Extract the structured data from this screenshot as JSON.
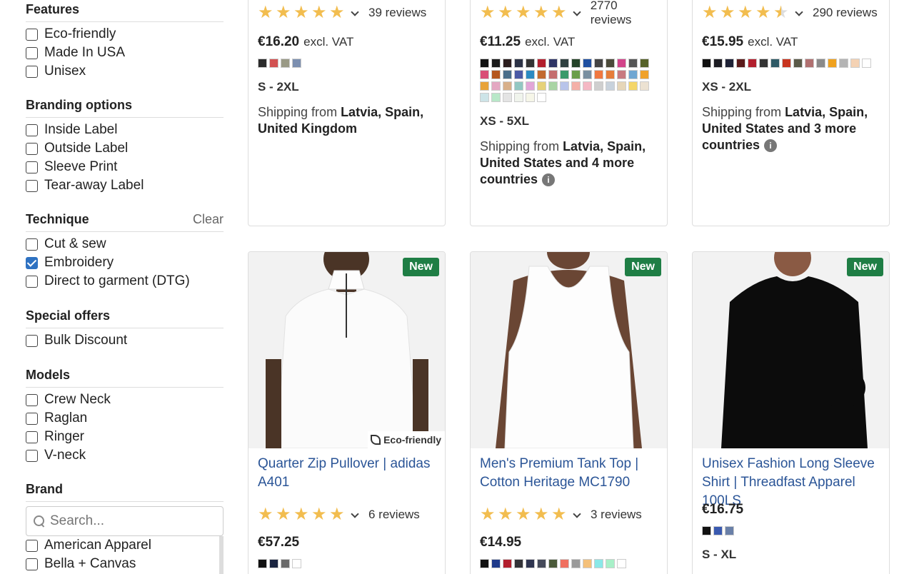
{
  "sidebar": {
    "features": {
      "title": "Features",
      "options": [
        {
          "label": "Eco-friendly",
          "checked": false
        },
        {
          "label": "Made In USA",
          "checked": false
        },
        {
          "label": "Unisex",
          "checked": false
        }
      ]
    },
    "branding": {
      "title": "Branding options",
      "options": [
        {
          "label": "Inside Label",
          "checked": false
        },
        {
          "label": "Outside Label",
          "checked": false
        },
        {
          "label": "Sleeve Print",
          "checked": false
        },
        {
          "label": "Tear-away Label",
          "checked": false
        }
      ]
    },
    "technique": {
      "title": "Technique",
      "clear_label": "Clear",
      "options": [
        {
          "label": "Cut & sew",
          "checked": false
        },
        {
          "label": "Embroidery",
          "checked": true
        },
        {
          "label": "Direct to garment (DTG)",
          "checked": false
        }
      ]
    },
    "special": {
      "title": "Special offers",
      "options": [
        {
          "label": "Bulk Discount",
          "checked": false
        }
      ]
    },
    "models": {
      "title": "Models",
      "options": [
        {
          "label": "Crew Neck",
          "checked": false
        },
        {
          "label": "Raglan",
          "checked": false
        },
        {
          "label": "Ringer",
          "checked": false
        },
        {
          "label": "V-neck",
          "checked": false
        }
      ]
    },
    "brand": {
      "title": "Brand",
      "search_placeholder": "Search...",
      "options": [
        {
          "label": "American Apparel",
          "checked": false
        },
        {
          "label": "Bella + Canvas",
          "checked": false
        }
      ]
    }
  },
  "top_cards": [
    {
      "rating": 5,
      "reviews": "39 reviews",
      "price": "€16.20",
      "vat": "excl. VAT",
      "colors": [
        "#2b2b2b",
        "#d25252",
        "#9a9a86",
        "#7c8fb0"
      ],
      "sizes": "S - 2XL",
      "ship_from": "Shipping from",
      "ship_places": "Latvia, Spain, United Kingdom",
      "ship_more": ""
    },
    {
      "rating": 5,
      "reviews": "2770 reviews",
      "price": "€11.25",
      "vat": "excl. VAT",
      "colors": [
        "#111111",
        "#1a1a1a",
        "#2b1d1d",
        "#2c3245",
        "#333333",
        "#b21f2d",
        "#2f3566",
        "#2f4040",
        "#234228",
        "#1f4fa0",
        "#444444",
        "#4a4a3a",
        "#d2448a",
        "#555555",
        "#56632a",
        "#d94e76",
        "#b5571e",
        "#4a6e8a",
        "#4b5aa5",
        "#2b8ac2",
        "#c26a2f",
        "#c46e6e",
        "#3a9a6a",
        "#6a9e4a",
        "#7a8fa0",
        "#f07840",
        "#e67d3a",
        "#c87a80",
        "#6fa6d2",
        "#f0a22a",
        "#e8a33a",
        "#e4a8c2",
        "#d8b08a",
        "#92c7c2",
        "#e2a6d8",
        "#e6d27a",
        "#a9d4a4",
        "#b8c4ea",
        "#f4b0a8",
        "#f4b8c4",
        "#cfcfcf",
        "#c8d2dc",
        "#e6d6b8",
        "#f4d66a",
        "#ece2d2",
        "#cde4e8",
        "#b8e8c8",
        "#e4e4e4",
        "#f0f4ec",
        "#f6f6e8",
        "#ffffff"
      ],
      "sizes": "XS - 5XL",
      "ship_from": "Shipping from",
      "ship_places": "Latvia, Spain, United States",
      "ship_more": "and 4 more countries"
    },
    {
      "rating": 4.5,
      "reviews": "290 reviews",
      "price": "€15.95",
      "vat": "excl. VAT",
      "colors": [
        "#111111",
        "#1c1c22",
        "#1e2236",
        "#5a1a1a",
        "#b21f2d",
        "#333333",
        "#2f5a66",
        "#c8341f",
        "#5a5a48",
        "#b07070",
        "#8a8a8a",
        "#f0a21e",
        "#b4b4b4",
        "#f4d2b4",
        "#ffffff"
      ],
      "sizes": "XS - 2XL",
      "ship_from": "Shipping from",
      "ship_places": "Latvia, Spain, United States",
      "ship_more": "and 3 more countries"
    }
  ],
  "bottom_cards": [
    {
      "badge": "New",
      "eco_badge": "Eco-friendly",
      "garment": "pullover",
      "title": "Quarter Zip Pullover | adidas A401",
      "rating": 5,
      "reviews": "6 reviews",
      "price": "€57.25",
      "colors": [
        "#111111",
        "#1a2440",
        "#6a6a6a",
        "#ffffff"
      ]
    },
    {
      "badge": "New",
      "eco_badge": "",
      "garment": "tank",
      "title": "Men's Premium Tank Top | Cotton Heritage MC1790",
      "rating": 5,
      "reviews": "3 reviews",
      "price": "€14.95",
      "colors": [
        "#111111",
        "#1f3a8a",
        "#b21f2d",
        "#333338",
        "#2f3550",
        "#454a5a",
        "#4a5a3a",
        "#f07060",
        "#9a9a9a",
        "#f4c07a",
        "#8ae8e8",
        "#a8f0c8",
        "#ffffff"
      ]
    },
    {
      "badge": "New",
      "eco_badge": "",
      "garment": "longsleeve",
      "title": "Unisex Fashion Long Sleeve Shirt | Threadfast Apparel 100LS",
      "rating": null,
      "reviews": "",
      "price": "€16.75",
      "colors": [
        "#111111",
        "#3a5ab0",
        "#6a80a8"
      ],
      "sizes": "S - XL"
    }
  ]
}
